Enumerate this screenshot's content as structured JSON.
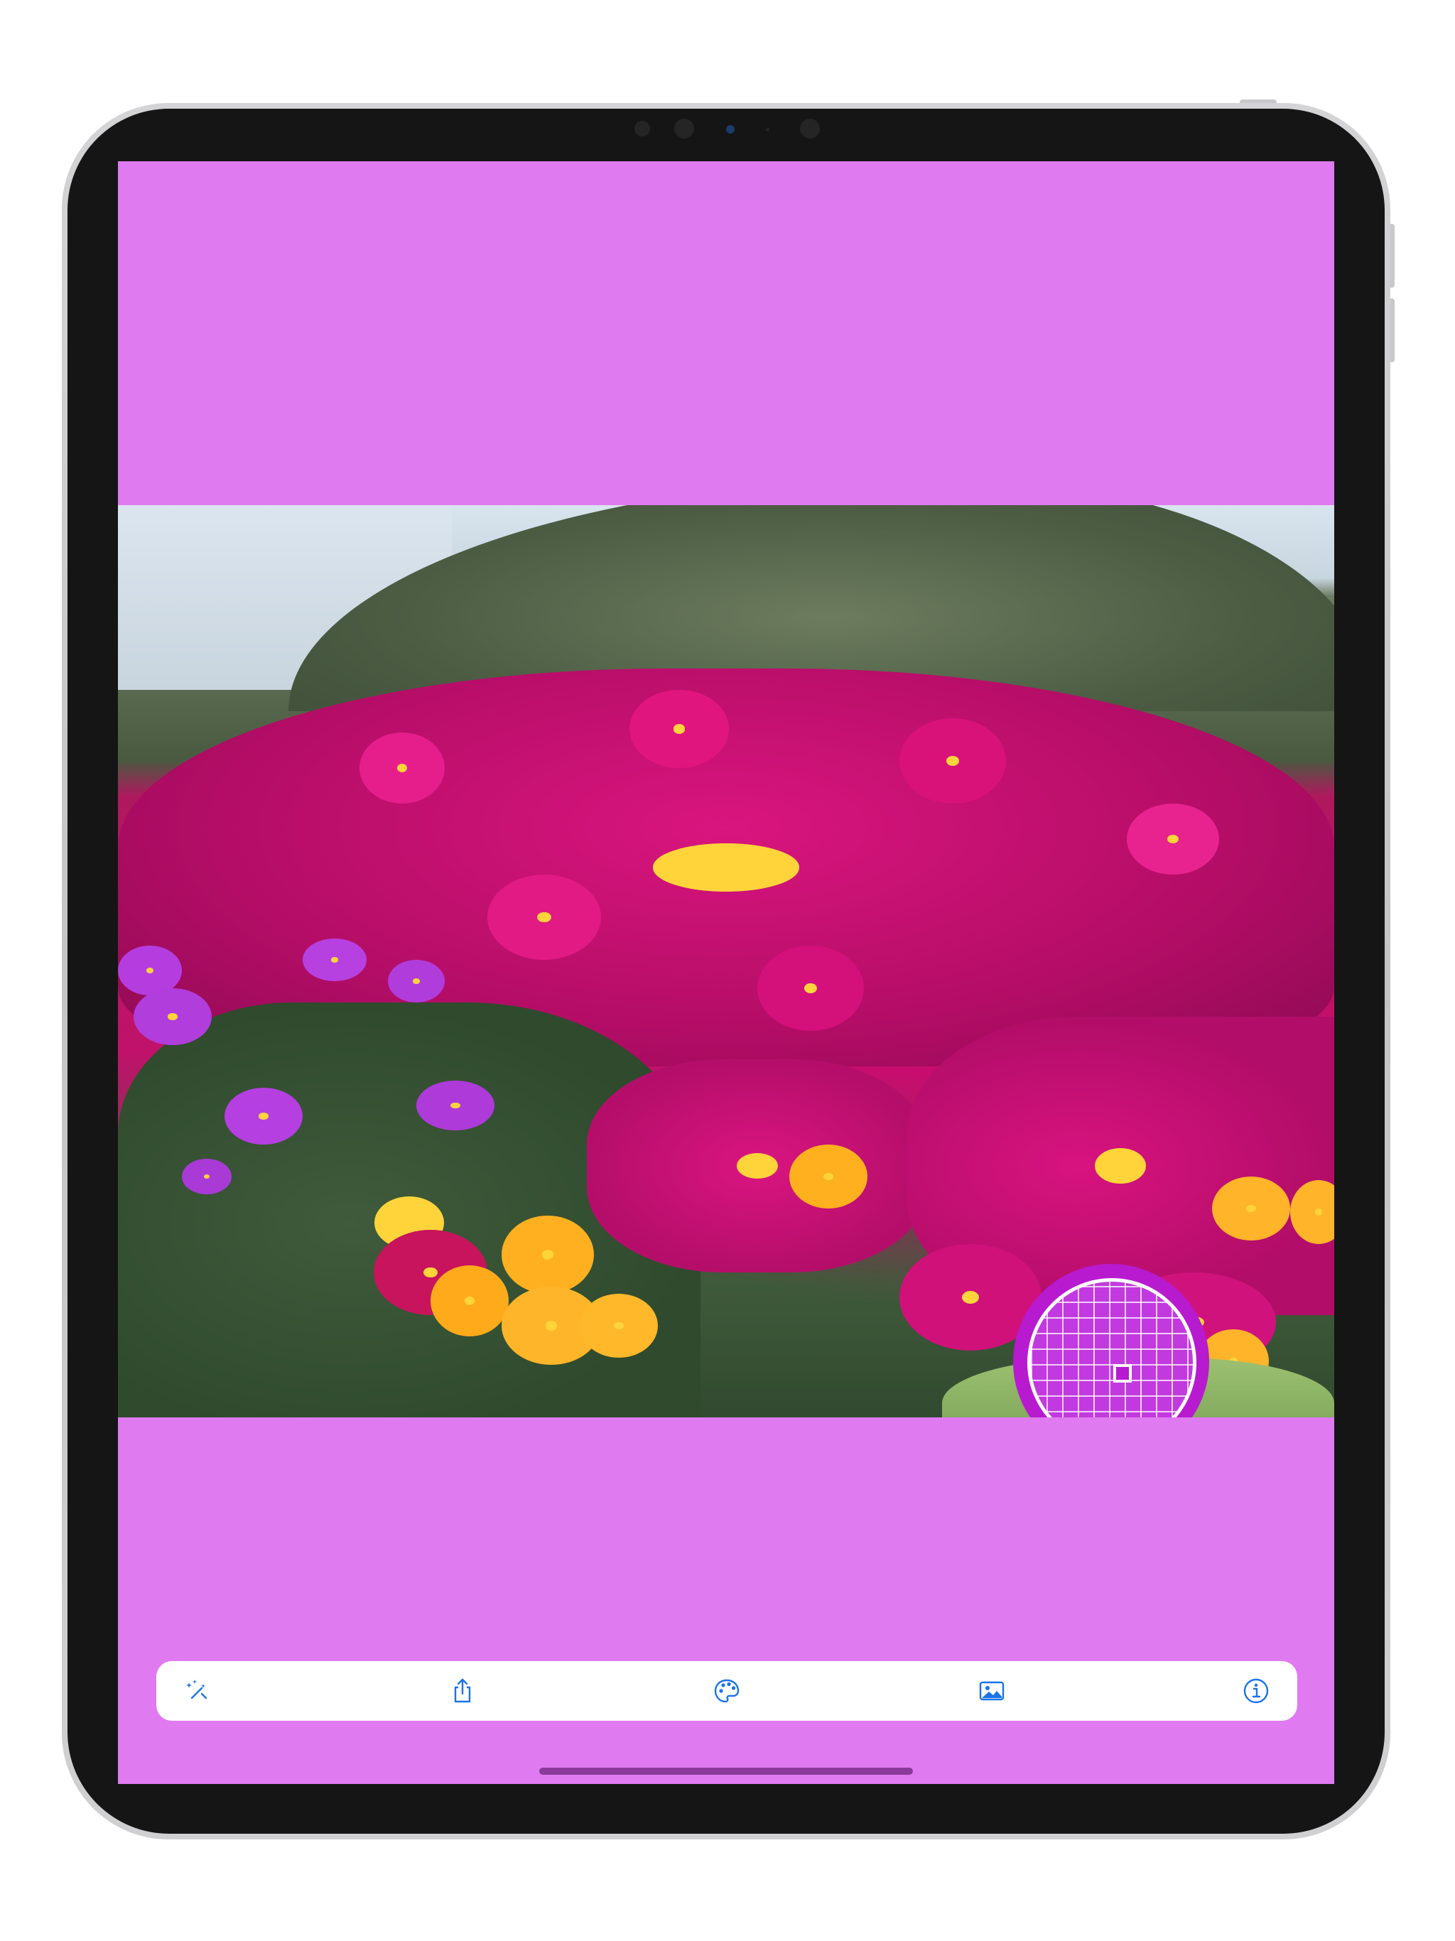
{
  "app": {
    "background_color": "#e07af0",
    "accent_color": "#1a73e8"
  },
  "photo": {
    "description_icon": "photo-canvas"
  },
  "loupe": {
    "icon": "color-picker-loupe",
    "sample_color": "#b81ad0"
  },
  "toolbar": {
    "items": [
      {
        "icon": "magic-wand-icon"
      },
      {
        "icon": "share-icon"
      },
      {
        "icon": "palette-icon"
      },
      {
        "icon": "photo-icon"
      },
      {
        "icon": "info-icon"
      }
    ]
  }
}
